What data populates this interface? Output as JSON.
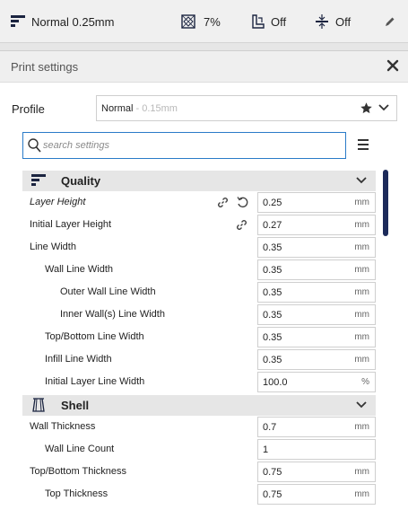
{
  "toolbar": {
    "profile_label": "Normal 0.25mm",
    "infill_label": "7%",
    "support_label": "Off",
    "adhesion_label": "Off"
  },
  "panel": {
    "title": "Print settings",
    "profile": {
      "label": "Profile",
      "name": "Normal",
      "sub": " - 0.15mm"
    },
    "search": {
      "placeholder": "search settings"
    }
  },
  "sections": {
    "quality": {
      "title": "Quality",
      "rows": [
        {
          "label": "Layer Height",
          "value": "0.25",
          "unit": "mm"
        },
        {
          "label": "Initial Layer Height",
          "value": "0.27",
          "unit": "mm"
        },
        {
          "label": "Line Width",
          "value": "0.35",
          "unit": "mm"
        },
        {
          "label": "Wall Line Width",
          "value": "0.35",
          "unit": "mm"
        },
        {
          "label": "Outer Wall Line Width",
          "value": "0.35",
          "unit": "mm"
        },
        {
          "label": "Inner Wall(s) Line Width",
          "value": "0.35",
          "unit": "mm"
        },
        {
          "label": "Top/Bottom Line Width",
          "value": "0.35",
          "unit": "mm"
        },
        {
          "label": "Infill Line Width",
          "value": "0.35",
          "unit": "mm"
        },
        {
          "label": "Initial Layer Line Width",
          "value": "100.0",
          "unit": "%"
        }
      ]
    },
    "shell": {
      "title": "Shell",
      "rows": [
        {
          "label": "Wall Thickness",
          "value": "0.7",
          "unit": "mm"
        },
        {
          "label": "Wall Line Count",
          "value": "1",
          "unit": ""
        },
        {
          "label": "Top/Bottom Thickness",
          "value": "0.75",
          "unit": "mm"
        },
        {
          "label": "Top Thickness",
          "value": "0.75",
          "unit": "mm"
        }
      ]
    }
  },
  "colors": {
    "accent": "#2a7bc8",
    "scrollbar": "#1c2a5a",
    "section_bg": "#e6e6e6"
  }
}
